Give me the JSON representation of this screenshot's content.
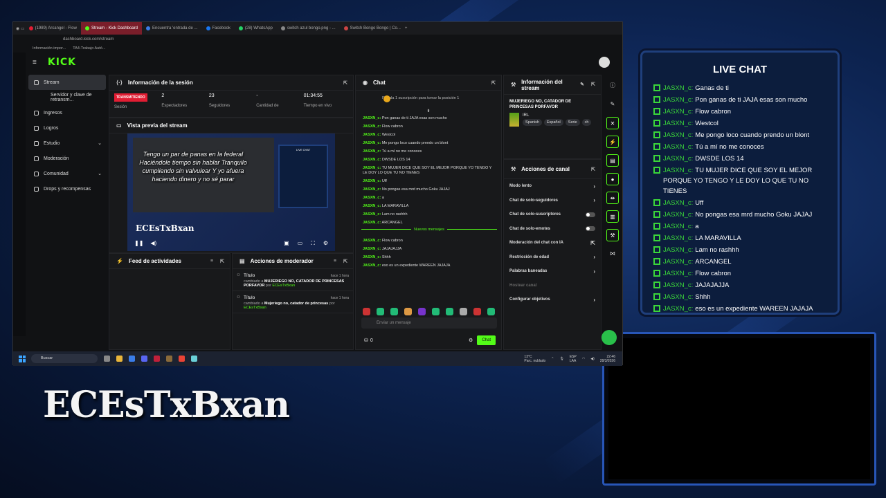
{
  "overlay": {
    "streamer_name": "ECEsTxBxan",
    "live_chat_title": "LIVE CHAT",
    "live_chat_messages": [
      {
        "user": "JASXN_c:",
        "text": "Ganas de ti"
      },
      {
        "user": "JASXN_c:",
        "text": "Pon ganas de ti JAJA esas son mucho"
      },
      {
        "user": "JASXN_c:",
        "text": "Flow cabron"
      },
      {
        "user": "JASXN_c:",
        "text": "Westcol"
      },
      {
        "user": "JASXN_c:",
        "text": "Me pongo loco cuando prendo un blont"
      },
      {
        "user": "JASXN_c:",
        "text": "Tú a mí no me conoces"
      },
      {
        "user": "JASXN_c:",
        "text": "DWSDE LOS 14"
      },
      {
        "user": "JASXN_c:",
        "text": "TU MUJER DICE QUE SOY EL MEJOR PORQUE YO TENGO Y LE DOY LO QUE TU NO TIENES"
      },
      {
        "user": "JASXN_c:",
        "text": "Uff"
      },
      {
        "user": "JASXN_c:",
        "text": "No pongas esa mrd mucho Goku JAJAJ"
      },
      {
        "user": "JASXN_c:",
        "text": "a"
      },
      {
        "user": "JASXN_c:",
        "text": "LA MARAVILLA"
      },
      {
        "user": "JASXN_c:",
        "text": "Lam no rashhh"
      },
      {
        "user": "JASXN_c:",
        "text": "ARCANGEL"
      },
      {
        "user": "JASXN_c:",
        "text": "Flow cabron"
      },
      {
        "user": "JASXN_c:",
        "text": "JAJAJAJJA"
      },
      {
        "user": "JASXN_c:",
        "text": "Shhh"
      },
      {
        "user": "JASXN_c:",
        "text": "eso es un expediente WAREEN JAJAJA"
      }
    ]
  },
  "browser": {
    "tabs": [
      "(1989) Arcangel - Flow",
      "Stream - Kick Dashboard",
      "Encuentra 'entrada de ...",
      "Facebook",
      "(28) WhatsApp",
      "switch azul bongo.png - ...",
      "Switch Bongo Bongo | Co..."
    ],
    "url": "dashboard.kick.com/stream",
    "bookmarks": [
      "Información impor...",
      "TA4-Trabajo Autó..."
    ]
  },
  "kick": {
    "logo": "KICK",
    "sidebar": [
      {
        "label": "Stream",
        "icon": "broadcast-icon"
      },
      {
        "label": "Servidor y clave de retransm..."
      },
      {
        "label": "Ingresos",
        "icon": "dollar-icon"
      },
      {
        "label": "Logros",
        "icon": "trophy-icon"
      },
      {
        "label": "Estudio",
        "icon": "studio-icon",
        "chev": "⌄"
      },
      {
        "label": "Moderación",
        "icon": "shield-icon"
      },
      {
        "label": "Comunidad",
        "icon": "people-icon",
        "chev": "⌄"
      },
      {
        "label": "Drops y recompensas",
        "icon": "gift-icon"
      }
    ],
    "session": {
      "title": "Información de la sesión",
      "badge": "TRANSMITIENDO",
      "stats": [
        {
          "value": "",
          "label": "Sesión"
        },
        {
          "value": "2",
          "label": "Espectadores"
        },
        {
          "value": "23",
          "label": "Seguidores"
        },
        {
          "value": "-",
          "label": "Cantidad de"
        },
        {
          "value": "01:34:55",
          "label": "Tiempo en vivo"
        }
      ]
    },
    "preview": {
      "title": "Vista previa del stream",
      "caption": "Tengo un par de panas en la federal Haciéndole tiempo sin hablar Tranquilo cumpliendo sin valvulear Y yo afuera haciendo dinero y no sé parar",
      "name": "ECEsTxBxan",
      "mini_chat": "LIVE CHAT"
    },
    "feed": {
      "title": "Feed de actividades"
    },
    "modactions": {
      "title": "Acciones de moderador",
      "items": [
        {
          "title": "Título",
          "time": "hace 1 hora",
          "pre": "cambiado a",
          "value": "MUJERIEGO NO, CATADOR DE PRINCESAS PORFAVOR",
          "by": "por",
          "user": "ECEsTxBxan"
        },
        {
          "title": "Título",
          "time": "hace 1 hora",
          "pre": "cambiado a",
          "value": "Mujeriego no, catador de princesas",
          "by": "por",
          "user": "ECEsTxBxan"
        }
      ]
    },
    "chat": {
      "title": "Chat",
      "pinned": "Regala 1 suscripción para tomar la posición 1",
      "messages": [
        {
          "user": "JASXN_c:",
          "text": "Pon ganas de ti JAJA esas son mucho"
        },
        {
          "user": "JASXN_c:",
          "text": "Flow cabron"
        },
        {
          "user": "JASXN_c:",
          "text": "Westcol"
        },
        {
          "user": "JASXN_c:",
          "text": "Me pongo loco cuando prendo un blont"
        },
        {
          "user": "JASXN_c:",
          "text": "Tú a mí no me conoces"
        },
        {
          "user": "JASXN_c:",
          "text": "DWSDE LOS 14"
        },
        {
          "user": "JASXN_c:",
          "text": "TU MUJER DICE QUE SOY EL MEJOR PORQUE YO TENGO Y LE DOY LO QUE TU NO TIENES"
        },
        {
          "user": "JASXN_c:",
          "text": "Uff"
        },
        {
          "user": "JASXN_c:",
          "text": "No pongas esa mrd mucho Goku JAJAJ"
        },
        {
          "user": "JASXN_c:",
          "text": "a"
        },
        {
          "user": "JASXN_c:",
          "text": "LA MARAVILLA"
        },
        {
          "user": "JASXN_c:",
          "text": "Lam no rashhh"
        },
        {
          "user": "JASXN_c:",
          "text": "ARCANGEL"
        }
      ],
      "new_label": "Nuevos mensajes",
      "new_messages": [
        {
          "user": "JASXN_c:",
          "text": "Flow cabron"
        },
        {
          "user": "JASXN_c:",
          "text": "JAJAJAJJA"
        },
        {
          "user": "JASXN_c:",
          "text": "Shhh"
        },
        {
          "user": "JASXN_c:",
          "text": "eso es un expediente WAREEN JAJAJA"
        }
      ],
      "placeholder": "Enviar un mensaje",
      "points": "0",
      "send": "Chat"
    },
    "streaminfo": {
      "title": "Información del stream",
      "stream_title": "MUJERIEGO NO, CATADOR DE PRINCESAS PORFAVOR",
      "category": "IRL",
      "tags": [
        "Spanish",
        "Español",
        "Serie",
        "ch"
      ]
    },
    "channel_actions": {
      "title": "Acciones de canal",
      "items": [
        {
          "label": "Modo lento",
          "kind": "arrow"
        },
        {
          "label": "Chat de solo-seguidores",
          "kind": "arrow"
        },
        {
          "label": "Chat de solo-suscriptores",
          "kind": "toggle"
        },
        {
          "label": "Chat de solo-emotes",
          "kind": "toggle"
        },
        {
          "label": "Moderación del chat con IA",
          "kind": "link"
        },
        {
          "label": "Restricción de edad",
          "kind": "arrow"
        },
        {
          "label": "Palabras baneadas",
          "kind": "arrow"
        },
        {
          "label": "Hostear canal",
          "kind": "disabled"
        },
        {
          "label": "Configurar objetivos",
          "kind": "arrow"
        }
      ]
    }
  },
  "taskbar": {
    "search": "Buscar",
    "weather": "13°C",
    "weather_sub": "Parc. nublado",
    "lang": "ESP",
    "lang_sub": "LAA",
    "time": "22:46",
    "date": "28/3/2026"
  }
}
